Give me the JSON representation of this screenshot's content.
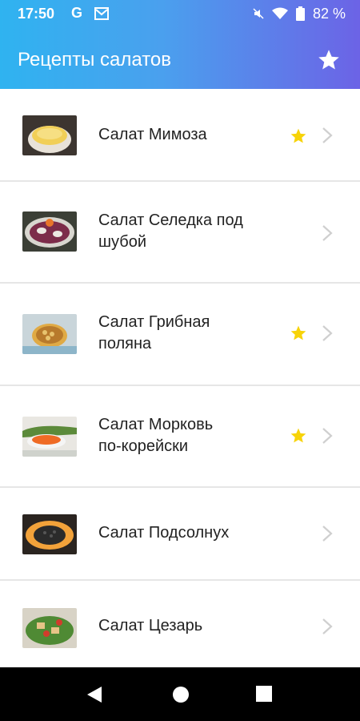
{
  "status_bar": {
    "time": "17:50",
    "g_label": "G",
    "battery_percent": "82 %",
    "icons": [
      "g-icon",
      "mail-icon",
      "mute-icon",
      "wifi-icon",
      "battery-icon"
    ]
  },
  "toolbar": {
    "title": "Рецепты салатов",
    "favorites_icon": "star-icon"
  },
  "recipes": [
    {
      "name": "Салат Мимоза",
      "favorite": true,
      "thumb": "mimosa-thumbnail"
    },
    {
      "name": "Салат Селедка под\nшубой",
      "favorite": false,
      "thumb": "herring-thumbnail"
    },
    {
      "name": "Салат Грибная\nполяна",
      "favorite": true,
      "thumb": "mushroom-thumbnail"
    },
    {
      "name": "Салат Морковь\nпо-корейски",
      "favorite": true,
      "thumb": "carrot-thumbnail"
    },
    {
      "name": "Салат Подсолнух",
      "favorite": false,
      "thumb": "sunflower-thumbnail"
    },
    {
      "name": "Салат Цезарь",
      "favorite": false,
      "thumb": "caesar-thumbnail"
    }
  ],
  "nav_bar": {
    "icons": [
      "back-icon",
      "home-icon",
      "recents-icon"
    ]
  },
  "colors": {
    "accent_start": "#2fb3f0",
    "accent_end": "#6c63e6",
    "favorite_star": "#f7d308",
    "chevron": "#cfcfcf"
  }
}
